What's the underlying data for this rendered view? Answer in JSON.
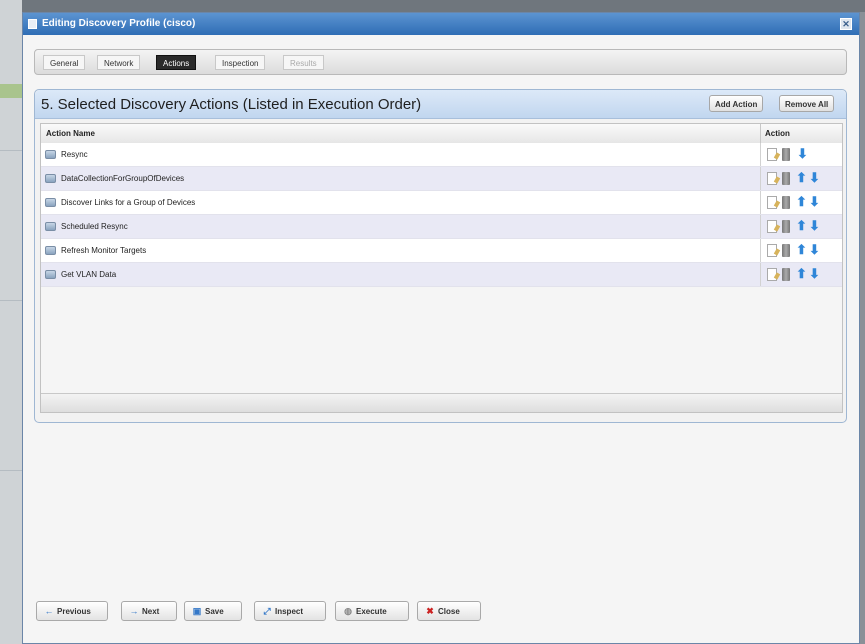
{
  "dialog": {
    "title": "Editing Discovery Profile (cisco)",
    "close_glyph": "✕"
  },
  "tabs": [
    {
      "label": "General",
      "state": "normal"
    },
    {
      "label": "Network",
      "state": "normal"
    },
    {
      "label": "Actions",
      "state": "active"
    },
    {
      "label": "Inspection",
      "state": "normal"
    },
    {
      "label": "Results",
      "state": "disabled"
    }
  ],
  "panel": {
    "title": "5. Selected Discovery Actions (Listed in Execution Order)",
    "add_action_label": "Add Action",
    "remove_all_label": "Remove All"
  },
  "grid": {
    "columns": [
      "Action Name",
      "Action"
    ],
    "rows": [
      {
        "name": "Resync",
        "icons": [
          "edit-icon",
          "delete-icon",
          "move-down-icon"
        ]
      },
      {
        "name": "DataCollectionForGroupOfDevices",
        "icons": [
          "edit-icon",
          "delete-icon",
          "move-up-icon",
          "move-down-icon"
        ]
      },
      {
        "name": "Discover Links for a Group of Devices",
        "icons": [
          "edit-icon",
          "delete-icon",
          "move-up-icon",
          "move-down-icon"
        ]
      },
      {
        "name": "Scheduled Resync",
        "icons": [
          "edit-icon",
          "delete-icon",
          "move-up-icon",
          "move-down-icon"
        ]
      },
      {
        "name": "Refresh Monitor Targets",
        "icons": [
          "edit-icon",
          "delete-icon",
          "move-up-icon",
          "move-down-icon"
        ]
      },
      {
        "name": "Get VLAN Data",
        "icons": [
          "edit-icon",
          "delete-icon",
          "move-up-icon",
          "move-down-icon"
        ]
      }
    ]
  },
  "footer": {
    "previous_label": "Previous",
    "next_label": "Next",
    "save_label": "Save",
    "inspect_label": "Inspect",
    "execute_label": "Execute",
    "close_label": "Close"
  },
  "colors": {
    "title_bar": "#3a7bc4",
    "panel_header": "#c9dcf2",
    "row_alt": "#e9e9f5",
    "arrow_blue": "#2f86d8",
    "close_red": "#cc2222"
  }
}
